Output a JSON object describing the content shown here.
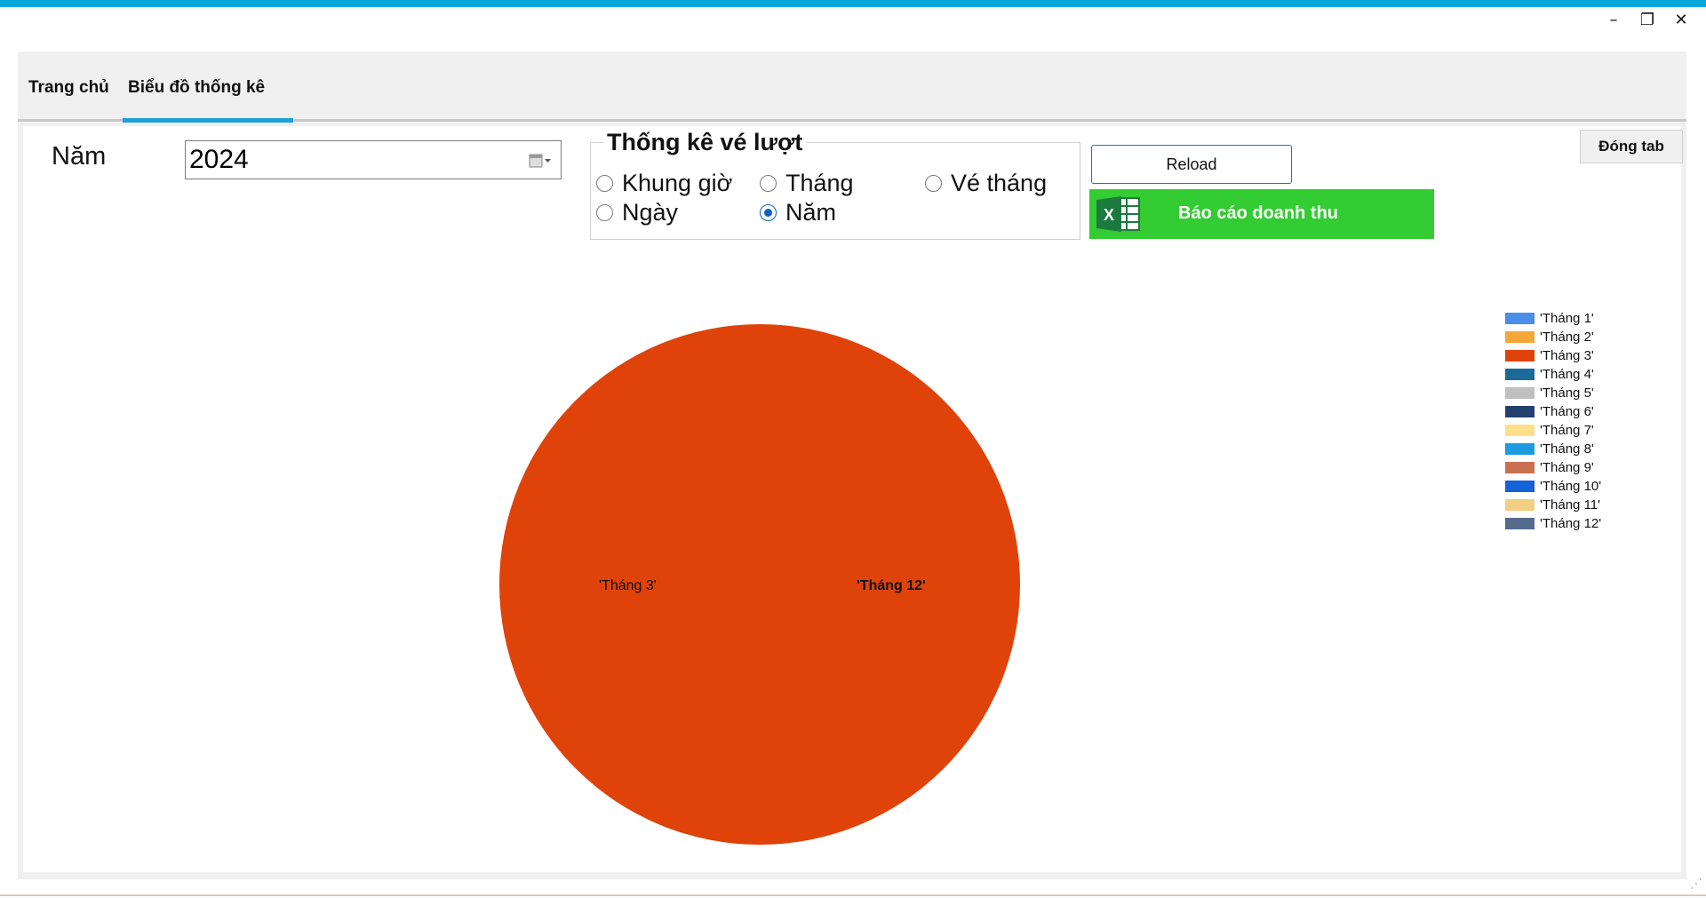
{
  "window": {
    "minimize_glyph": "–",
    "restore_glyph": "❐",
    "close_glyph": "✕",
    "grip_glyph": "⋰"
  },
  "tabs": [
    {
      "label": "Trang chủ"
    },
    {
      "label": "Biểu đồ thống kê"
    }
  ],
  "filters": {
    "year_label": "Năm",
    "year_value": "2024",
    "group_title": "Thống kê vé lượt",
    "options": {
      "khung_gio": "Khung giờ",
      "thang": "Tháng",
      "ve_thang": "Vé tháng",
      "ngay": "Ngày",
      "nam": "Năm"
    },
    "selected": "Năm"
  },
  "buttons": {
    "reload": "Reload",
    "report": "Báo cáo doanh thu",
    "close_tab": "Đóng tab"
  },
  "colors": {
    "accent": "#00a8d8",
    "tab_underline": "#1ea0dc",
    "report_button": "#33cc33",
    "pie_fill": "#df430a"
  },
  "chart_data": {
    "type": "pie",
    "legend_position": "right",
    "categories": [
      "'Tháng 1'",
      "'Tháng 2'",
      "'Tháng 3'",
      "'Tháng 4'",
      "'Tháng 5'",
      "'Tháng 6'",
      "'Tháng 7'",
      "'Tháng 8'",
      "'Tháng 9'",
      "'Tháng 10'",
      "'Tháng 11'",
      "'Tháng 12'"
    ],
    "values": [
      0,
      0,
      100,
      0,
      0,
      0,
      0,
      0,
      0,
      0,
      0,
      0
    ],
    "colors": [
      "#4a8ee8",
      "#f5a83a",
      "#df430a",
      "#1b6a9a",
      "#bfbfbf",
      "#23406e",
      "#ffe08a",
      "#1e9be0",
      "#c8704f",
      "#1463d8",
      "#f2cf82",
      "#546b8c"
    ],
    "slice_label": "'Tháng 3'",
    "overlapping_label": "'Tháng 12'"
  }
}
